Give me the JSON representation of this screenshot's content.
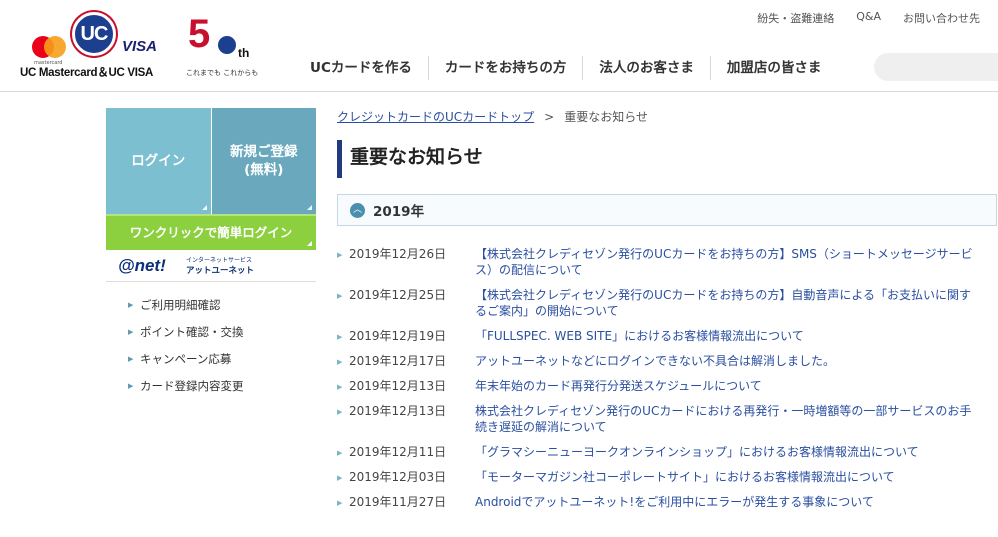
{
  "brand": {
    "mastercard_sub": "mastercard",
    "uc_mark": "UC",
    "visa_mark": "VISA",
    "tagline": "UC Mastercard＆UC VISA",
    "anniversary_number": "5",
    "anniversary_suffix": "th",
    "anniversary_motto": "これまでも これからも"
  },
  "utility_links": [
    "紛失・盗難連絡",
    "Q&A",
    "お問い合わせ先"
  ],
  "main_nav": [
    "UCカードを作る",
    "カードをお持ちの方",
    "法人のお客さま",
    "加盟店の皆さま"
  ],
  "sidebar": {
    "login": "ログイン",
    "signup_line1": "新規ご登録",
    "signup_line2": "(無料)",
    "oneclick": "ワンクリックで簡単ログイン",
    "atnet_logo": "@net!",
    "atnet_sub1": "インターネットサービス",
    "atnet_sub2": "アットユーネット",
    "links": [
      "ご利用明細確認",
      "ポイント確認・交換",
      "キャンペーン応募",
      "カード登録内容変更"
    ]
  },
  "breadcrumb": {
    "home": "クレジットカードのUCカードトップ",
    "separator": ">",
    "current": "重要なお知らせ"
  },
  "page_title": "重要なお知らせ",
  "year_section": {
    "toggle_symbol": "︿",
    "label": "2019年"
  },
  "news": [
    {
      "date": "2019年12月26日",
      "title": "【株式会社クレディセゾン発行のUCカードをお持ちの方】SMS（ショートメッセージサービス）の配信について"
    },
    {
      "date": "2019年12月25日",
      "title": "【株式会社クレディセゾン発行のUCカードをお持ちの方】自動音声による「お支払いに関するご案内」の開始について"
    },
    {
      "date": "2019年12月19日",
      "title": "「FULLSPEC. WEB SITE」におけるお客様情報流出について"
    },
    {
      "date": "2019年12月17日",
      "title": "アットユーネットなどにログインできない不具合は解消しました。"
    },
    {
      "date": "2019年12月13日",
      "title": "年末年始のカード再発行分発送スケジュールについて"
    },
    {
      "date": "2019年12月13日",
      "title": "株式会社クレディセゾン発行のUCカードにおける再発行・一時増額等の一部サービスのお手続き遅延の解消について"
    },
    {
      "date": "2019年12月11日",
      "title": "「グラマシーニューヨークオンラインショップ」におけるお客様情報流出について"
    },
    {
      "date": "2019年12月03日",
      "title": "「モーターマガジン社コーポレートサイト」におけるお客様情報流出について"
    },
    {
      "date": "2019年11月27日",
      "title": "Androidでアットユーネット!をご利用中にエラーが発生する事象について"
    }
  ],
  "colors": {
    "login_tile": "#7bbfd0",
    "signup_tile": "#6aa9bd",
    "oneclick": "#8ccf3f",
    "link": "#2a4fa0",
    "title_accent": "#223a80",
    "brand_red": "#c8102e",
    "brand_navy": "#1d3f8f"
  }
}
